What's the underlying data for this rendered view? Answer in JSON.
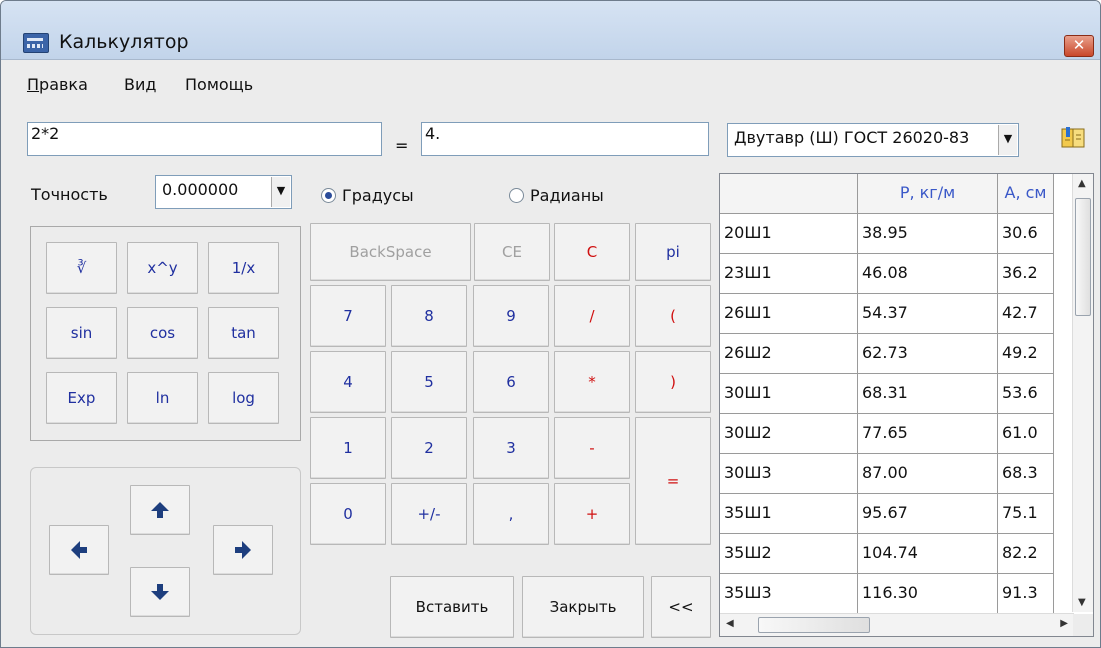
{
  "window": {
    "title": "Калькулятор",
    "close_label": "✕"
  },
  "menu": [
    {
      "accel": "П",
      "rest": "равка"
    },
    {
      "accel": "",
      "rest": "Вид"
    },
    {
      "accel": "",
      "rest": "Помощь"
    }
  ],
  "expression": {
    "value": "2*2",
    "equals": "=",
    "result": "4."
  },
  "precision": {
    "label": "Точность",
    "value": "0.000000"
  },
  "angle_mode": {
    "degrees": "Градусы",
    "radians": "Радианы",
    "selected": "degrees"
  },
  "function_buttons": {
    "root": "∛",
    "power": "x^y",
    "inverse": "1/x",
    "sin": "sin",
    "cos": "cos",
    "tan": "tan",
    "exp": "Exp",
    "ln": "ln",
    "log": "log"
  },
  "keypad": {
    "backspace": "BackSpace",
    "ce": "CE",
    "c": "C",
    "pi": "pi",
    "d7": "7",
    "d8": "8",
    "d9": "9",
    "div": "/",
    "lparen": "(",
    "d4": "4",
    "d5": "5",
    "d6": "6",
    "mul": "*",
    "rparen": ")",
    "d1": "1",
    "d2": "2",
    "d3": "3",
    "sub": "-",
    "eq": "=",
    "d0": "0",
    "sign": "+/-",
    "dot": ",",
    "add": "+"
  },
  "actions": {
    "insert": "Вставить",
    "close": "Закрыть",
    "collapse": "<<"
  },
  "profile": {
    "selected": "Двутавр (Ш) ГОСТ 26020-83"
  },
  "table": {
    "headers": [
      "",
      "P, кг/м",
      "A, см"
    ],
    "rows": [
      [
        "20Ш1",
        "38.95",
        "30.6"
      ],
      [
        "23Ш1",
        "46.08",
        "36.2"
      ],
      [
        "26Ш1",
        "54.37",
        "42.7"
      ],
      [
        "26Ш2",
        "62.73",
        "49.2"
      ],
      [
        "30Ш1",
        "68.31",
        "53.6"
      ],
      [
        "30Ш2",
        "77.65",
        "61.0"
      ],
      [
        "30Ш3",
        "87.00",
        "68.3"
      ],
      [
        "35Ш1",
        "95.67",
        "75.1"
      ],
      [
        "35Ш2",
        "104.74",
        "82.2"
      ],
      [
        "35Ш3",
        "116.30",
        "91.3"
      ]
    ]
  }
}
